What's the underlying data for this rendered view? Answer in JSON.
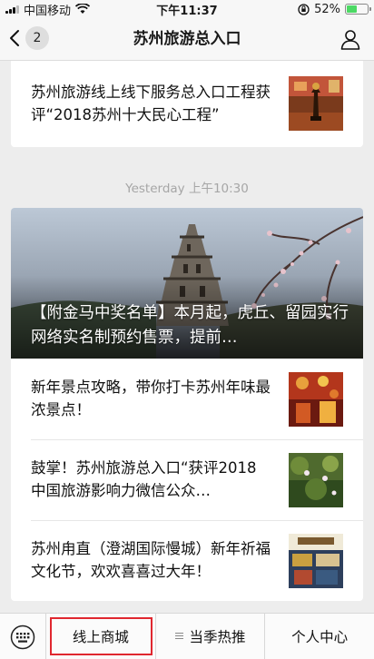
{
  "status_bar": {
    "carrier": "中国移动",
    "time": "下午11:37",
    "battery_percent": "52%",
    "battery_level": 0.52
  },
  "nav": {
    "back_count": "2",
    "title": "苏州旅游总入口"
  },
  "top_card": {
    "title": "苏州旅游线上线下服务总入口工程获评“2018苏州十大民心工程”"
  },
  "timestamp": "Yesterday 上午10:30",
  "feed": {
    "hero_title": "【附金马中奖名单】本月起，虎丘、留园实行网络实名制预约售票，提前…",
    "articles": [
      {
        "title": "新年景点攻略，带你打卡苏州年味最浓景点！"
      },
      {
        "title": "鼓掌！苏州旅游总入口“获评2018中国旅游影响力微信公众…"
      },
      {
        "title": "苏州甪直（澄湖国际慢城）新年祈福文化节，欢欢喜喜过大年！"
      }
    ]
  },
  "menu": {
    "items": [
      "线上商城",
      "当季热推",
      "个人中心"
    ],
    "highlight_color": "#e0272f"
  }
}
